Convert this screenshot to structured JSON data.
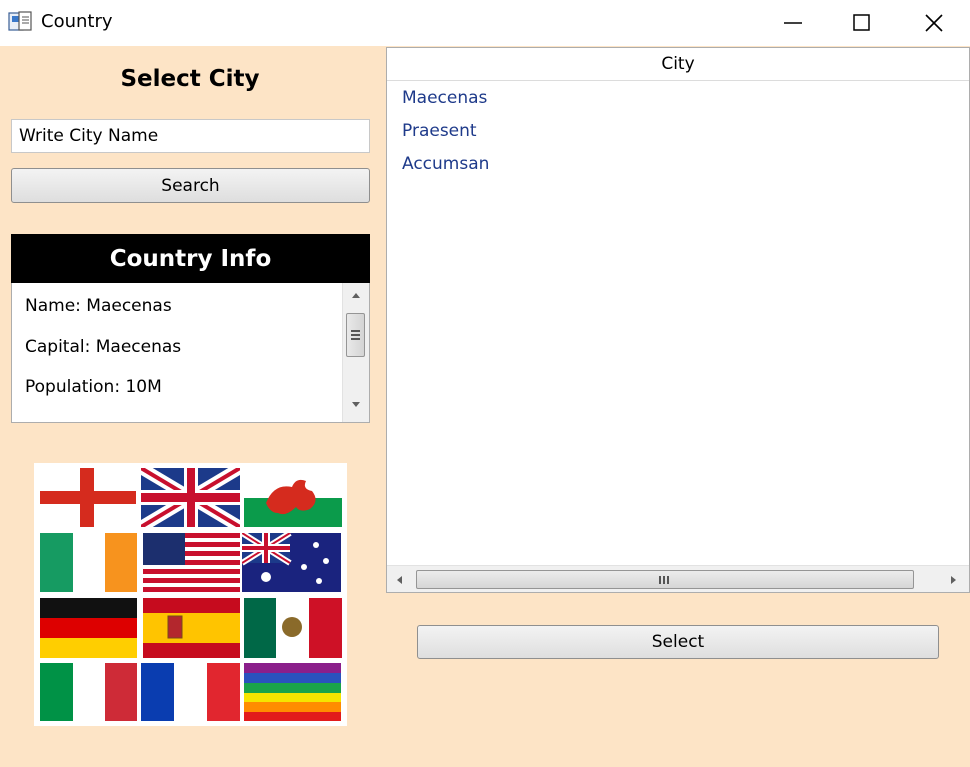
{
  "window": {
    "title": "Country",
    "controls": [
      "minimize-icon",
      "maximize-icon",
      "close-icon"
    ]
  },
  "left_panel": {
    "heading": "Select City",
    "search_input": {
      "value": "Write City Name",
      "placeholder": ""
    },
    "search_button": "Search",
    "country_info": {
      "header": "Country Info",
      "lines": [
        "Name: Maecenas",
        "Capital: Maecenas",
        "Population: 10M"
      ]
    },
    "flags_image": {
      "icon": "flags-collage-image",
      "flags": [
        "England",
        "United Kingdom",
        "Wales",
        "Ireland",
        "United States",
        "Australia",
        "Germany",
        "Spain",
        "Mexico",
        "Italy",
        "France",
        "Rainbow"
      ]
    }
  },
  "city_list": {
    "column_header": "City",
    "items": [
      "Maecenas",
      "Praesent",
      "Accumsan"
    ]
  },
  "select_button": "Select",
  "colors": {
    "background": "#fde4c6",
    "info_header": "#000000",
    "list_item_text": "#1e3a8a"
  }
}
